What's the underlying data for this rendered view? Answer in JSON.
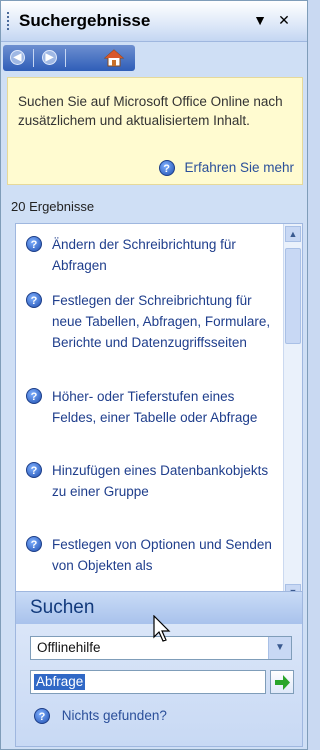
{
  "pane": {
    "title": "Suchergebnisse",
    "title_buttons": {
      "dropdown_icon": "triangle-down",
      "close_icon": "x"
    }
  },
  "nav": {
    "back_icon": "back-circle-icon",
    "forward_icon": "forward-circle-icon",
    "home_icon": "home-icon"
  },
  "info": {
    "text": "Suchen Sie auf Microsoft Office Online nach zusätzlichem und aktualisiertem Inhalt.",
    "learn_more": "Erfahren Sie mehr"
  },
  "results": {
    "count_label": "20 Ergebnisse",
    "items": [
      {
        "label": "Ändern der Schreibrichtung für Abfragen"
      },
      {
        "label": "Festlegen der Schreibrichtung für neue Tabellen, Abfragen, Formulare, Berichte und Datenzugriffsseiten"
      },
      {
        "label": "Höher- oder Tieferstufen eines Feldes, einer Tabelle oder Abfrage"
      },
      {
        "label": "Hinzufügen eines Datenbankobjekts zu einer Gruppe"
      },
      {
        "label": "Festlegen von Optionen und Senden von Objekten als"
      }
    ]
  },
  "search": {
    "title": "Suchen",
    "scope_value": "Offlinehilfe",
    "query_value": "Abfrage",
    "nothing_found": "Nichts gefunden?"
  },
  "colors": {
    "accent": "#2f5eb8",
    "link": "#1f3e8c",
    "info_bg": "#fffbd0",
    "go_arrow": "#2aa52a"
  }
}
